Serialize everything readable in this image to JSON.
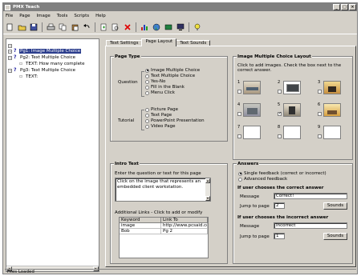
{
  "window": {
    "title": "PMX Teach"
  },
  "menu": [
    "File",
    "Page",
    "Image",
    "Tools",
    "Scripts",
    "Help"
  ],
  "toolbar": {
    "icons": [
      "new-icon",
      "open-icon",
      "save-icon",
      "print-icon",
      "copy-icon",
      "paste-icon",
      "undo-icon",
      "add-page-icon",
      "delete-icon",
      "chart-icon",
      "world-icon",
      "preview-icon",
      "monitor-icon",
      "help-icon"
    ]
  },
  "tree": {
    "items": [
      {
        "label": "Pg1: Image Multiple Choice",
        "selected": true
      },
      {
        "label": "Pg2: Text Multiple Choice",
        "selected": false
      },
      {
        "label": "TEXT: How many complete",
        "selected": false
      },
      {
        "label": "Pg3: Text Multiple Choice",
        "selected": false
      },
      {
        "label": "TEXT:",
        "selected": false
      }
    ]
  },
  "tabs": [
    "Text Settings",
    "Page Layout",
    "Text Sounds"
  ],
  "page_type": {
    "title": "Page Type",
    "question_label": "Question",
    "tutorial_label": "Tutorial",
    "question_options": [
      "Image Multiple Choice",
      "Text Multiple Choice",
      "Yes-No",
      "Fill in the Blank",
      "Menu Click"
    ],
    "tutorial_options": [
      "Picture Page",
      "Text Page",
      "PowerPoint Presentation",
      "Video Page"
    ]
  },
  "image_layout": {
    "title": "Image Multiple Choice Layout",
    "instructions": "Click to add images. Check the box next to the correct answer.",
    "numbers": [
      "1",
      "2",
      "3",
      "4",
      "5",
      "6",
      "7",
      "8",
      "9"
    ]
  },
  "intro_text": {
    "title": "Intro Text",
    "hint": "Enter the question or text for this page",
    "content": "Click on the image that represents an embedded client workstation.",
    "links_hint": "Additional Links - Click to add or modify",
    "link_headers": [
      "Keyword",
      "Link To"
    ],
    "links": [
      {
        "keyword": "image",
        "link": "http://www.pcsaid.com"
      },
      {
        "keyword": "Bob",
        "link": "Pg 2"
      }
    ]
  },
  "answers": {
    "title": "Answers",
    "options": [
      "Single feedback (correct or incorrect)",
      "Advanced feedback"
    ],
    "correct_title": "If user chooses the correct answer",
    "incorrect_title": "If user chooses the incorrect answer",
    "message_label": "Message",
    "jump_label": "Jump to page",
    "correct_message": "Correct!",
    "incorrect_message": "Incorrect",
    "correct_jump": "2",
    "incorrect_jump": "1",
    "sound_button": "Sounds"
  },
  "status": {
    "text": "Files Loaded"
  }
}
